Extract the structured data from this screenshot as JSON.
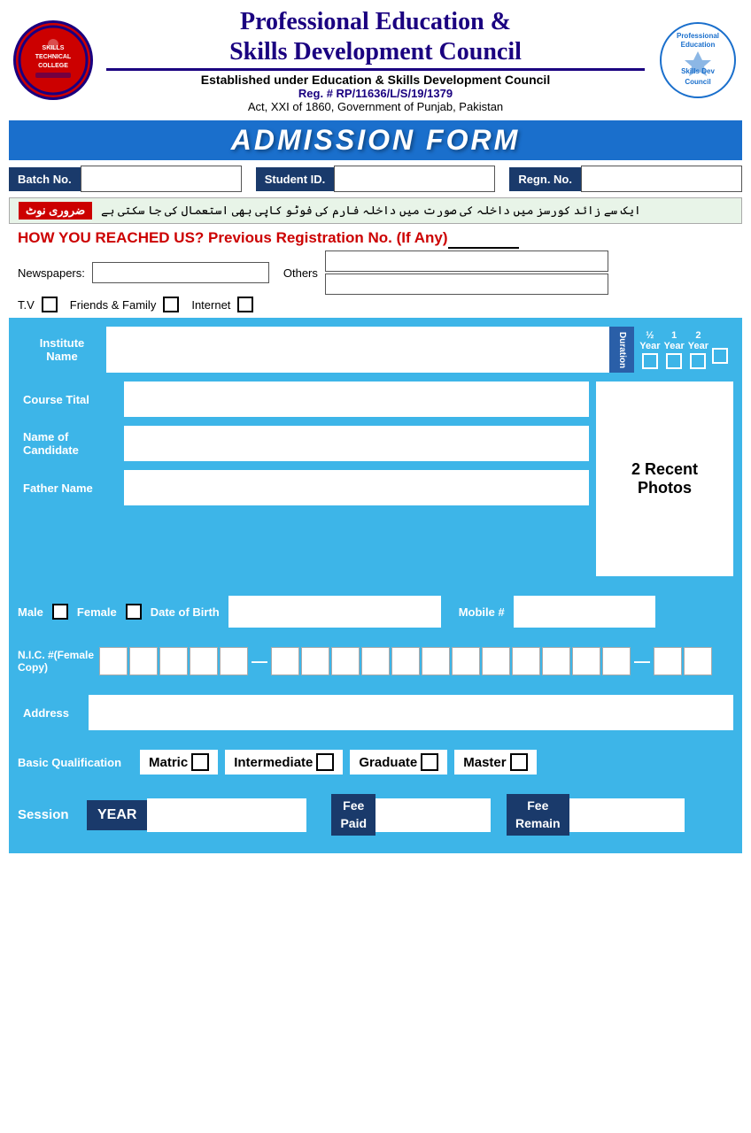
{
  "header": {
    "title_line1": "Professional Education &",
    "title_line2": "Skills Development Council",
    "subtitle": "Established under Education & Skills Development Council",
    "reg": "Reg. # RP/11636/L/S/19/1379",
    "act": "Act, XXI of 1860, Government of Punjab, Pakistan",
    "admission_title": "ADMISSION FORM"
  },
  "note": {
    "badge": "ضروری نوٹ",
    "text": "ایک سے زائد کورسز میں داخلہ کی صورت میں داخلہ فارم کی فوٹو کاپی بھی استعمال کی جا سکتی ہے"
  },
  "how_reached": {
    "text": "HOW YOU REACHED US?   Previous Registration No. (If Any)",
    "newspapers_label": "Newspapers:",
    "others_label": "Others",
    "tv_label": "T.V",
    "friends_label": "Friends & Family",
    "internet_label": "Internet"
  },
  "form": {
    "batch_label": "Batch No.",
    "student_id_label": "Student ID.",
    "regn_label": "Regn. No.",
    "institute_label": "Institute\nName",
    "duration_label": "Duration",
    "half_year": "½\nYear",
    "one_year": "1\nYear",
    "two_year": "2\nYear",
    "course_title_label": "Course Tital",
    "photos_text": "2 Recent\nPhotos",
    "name_candidate_label": "Name of Candidate",
    "father_name_label": "Father Name",
    "male_label": "Male",
    "female_label": "Female",
    "dob_label": "Date of Birth",
    "mobile_label": "Mobile #",
    "nic_label": "N.I.C. #(Female Copy)",
    "address_label": "Address",
    "basic_qual_label": "Basic Qualification",
    "matric_label": "Matric",
    "intermediate_label": "Intermediate",
    "graduate_label": "Graduate",
    "master_label": "Master",
    "session_label": "Session",
    "year_label": "YEAR",
    "fee_paid_label": "Fee\nPaid",
    "fee_remain_label": "Fee\nRemain"
  }
}
